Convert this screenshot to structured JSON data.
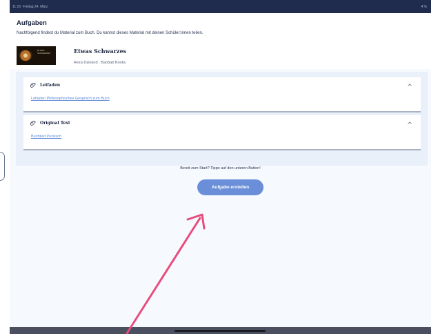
{
  "statusbar": {
    "time": "11:23",
    "date": "Freitag 24. März",
    "battery": "4 %"
  },
  "page": {
    "title": "Aufgaben",
    "subtitle": "Nachfolgend findest du Material zum Buch. Du kannst dieses Material mit deinen Schüler:innen teilen."
  },
  "book": {
    "title": "Etwas Schwarzes",
    "meta": "Reza Dalvand · Baobab Books",
    "cover_text": "ETWAS SCHWARZES"
  },
  "materials": [
    {
      "label": "Leifaden",
      "link": "Leifaden Philosophisches Gespräch zum Buch",
      "icon": "paperclip-icon"
    },
    {
      "label": "Original Text",
      "link": "Buchtext Persisch",
      "icon": "paperclip-icon"
    }
  ],
  "prompt": "Bereit zum Start? Tippe auf den unteren Button!",
  "button": {
    "label": "Aufgabe erstellen",
    "color": "#6a8fd8"
  },
  "annotation": {
    "color": "#e84c7c",
    "icon": "arrow-icon"
  }
}
